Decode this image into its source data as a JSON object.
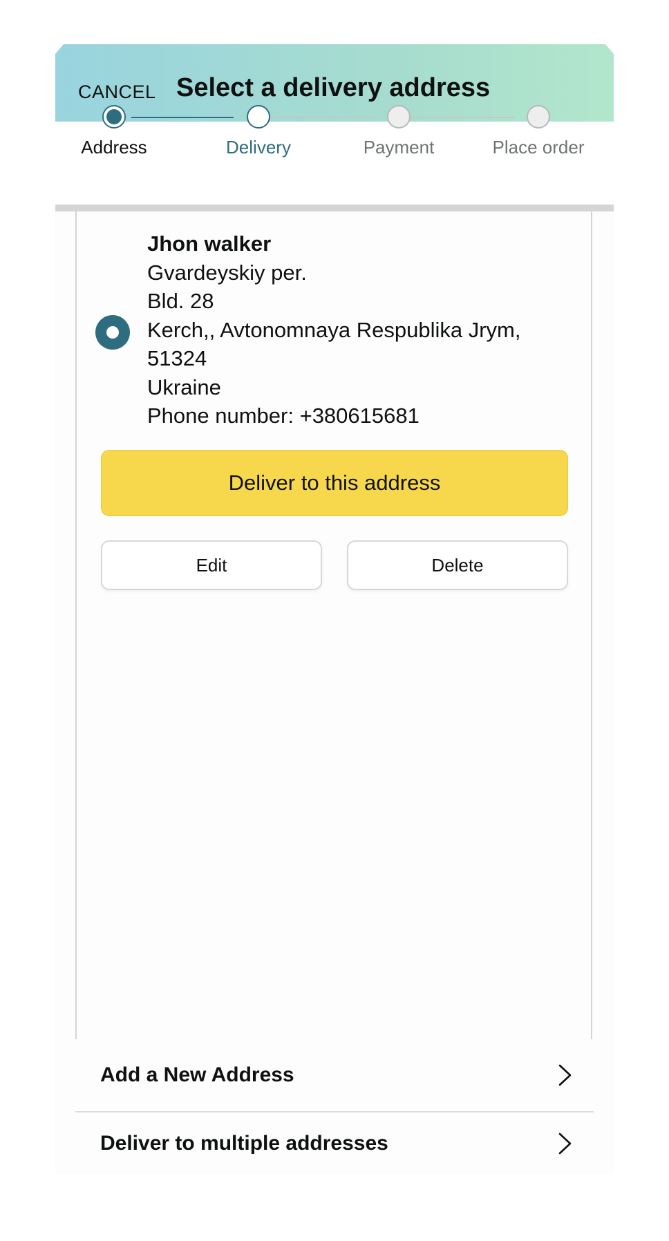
{
  "header": {
    "cancel_label": "CANCEL",
    "title": "Select a delivery address"
  },
  "stepper": {
    "steps": [
      {
        "label": "Address",
        "state": "done"
      },
      {
        "label": "Delivery",
        "state": "current"
      },
      {
        "label": "Payment",
        "state": "todo"
      },
      {
        "label": "Place order",
        "state": "todo"
      }
    ]
  },
  "address": {
    "selected": true,
    "name": "Jhon walker",
    "line1": "Gvardeyskiy per.",
    "line2": "Bld. 28",
    "city_region": "Kerch,, Avtonomnaya Respublika Jrym,",
    "postal_code": "51324",
    "country": "Ukraine",
    "phone": "Phone number: +380615681"
  },
  "actions": {
    "deliver_label": "Deliver to this address",
    "edit_label": "Edit",
    "delete_label": "Delete"
  },
  "options": {
    "add_new_label": "Add a New Address",
    "multiple_label": "Deliver to multiple addresses"
  },
  "icons": {
    "chevron": "chevron-right-icon"
  },
  "colors": {
    "accent": "#2e6c80",
    "deliver_button": "#f7d84d",
    "header_gradient_start": "#99d4df",
    "header_gradient_end": "#b2e6cc"
  }
}
